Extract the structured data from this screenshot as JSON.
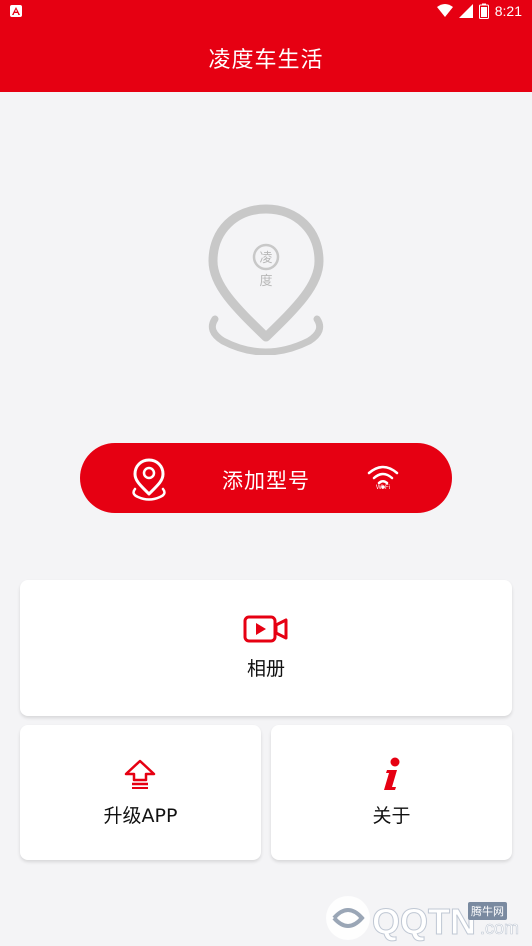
{
  "status_bar": {
    "time": "8:21"
  },
  "app_bar": {
    "title": "凌度车生活"
  },
  "hero": {
    "pin_text_top": "凌",
    "pin_text_bottom": "度"
  },
  "add_model": {
    "label": "添加型号",
    "wifi_label": "Wi-Fi"
  },
  "menu": {
    "album_label": "相册",
    "upgrade_label": "升级APP",
    "about_label": "关于"
  },
  "watermark": {
    "brand": "QQTN",
    "suffix": ".com",
    "tag": "腾牛网"
  },
  "colors": {
    "primary": "#e60012",
    "background": "#f4f4f6",
    "pin_gray": "#c8c8c8"
  }
}
